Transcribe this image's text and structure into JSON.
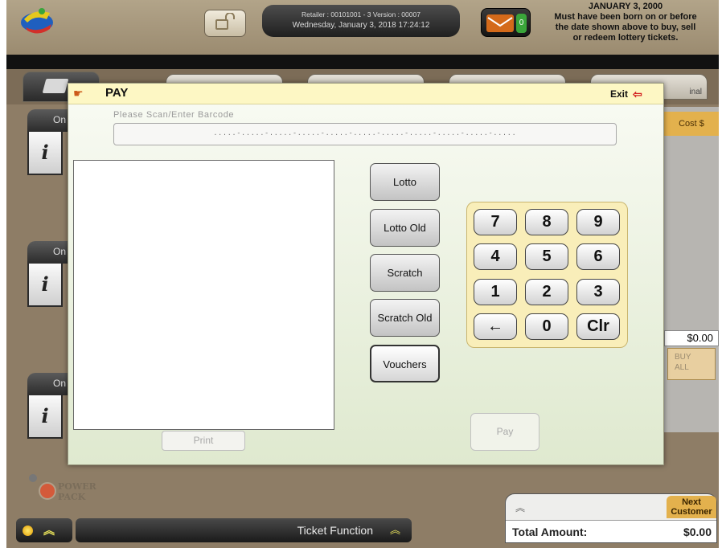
{
  "header": {
    "retailer_line": "Retailer : 00101001 - 3     Version : 00007",
    "datetime_line": "Wednesday, January 3, 2018 17:24:12",
    "mail_count": "0",
    "age_notice_date": "JANUARY 3, 2000",
    "age_notice_lines": [
      "Must have been born on or before",
      "the date shown above to buy, sell",
      "or redeem lottery tickets."
    ]
  },
  "side_panels": [
    {
      "header": "On",
      "info": "i"
    },
    {
      "header": "On",
      "info": "i"
    },
    {
      "header": "On",
      "info": "i"
    }
  ],
  "tabs": {
    "partial_label": "inal"
  },
  "right_panel": {
    "cost_header": "Cost $",
    "cost_amount": "$0.00",
    "buy_all": [
      "BUY",
      "ALL"
    ]
  },
  "dialog": {
    "title": "PAY",
    "exit_label": "Exit",
    "scan_label": "Please Scan/Enter Barcode",
    "scan_mask": ".....-.....-.....-.....-.....-.....-.....-.....-.....-.....-.....",
    "type_buttons": [
      "Lotto",
      "Lotto Old",
      "Scratch",
      "Scratch Old",
      "Vouchers"
    ],
    "keypad": [
      "7",
      "8",
      "9",
      "4",
      "5",
      "6",
      "1",
      "2",
      "3",
      "←",
      "0",
      "Clr"
    ],
    "print_label": "Print",
    "pay_label": "Pay"
  },
  "bottom": {
    "power_pack": [
      "POWER",
      "PACK"
    ],
    "ticket_function": "Ticket Function",
    "next_customer": [
      "Next",
      "Customer"
    ],
    "total_label": "Total Amount:",
    "total_value": "$0.00"
  },
  "colors": {
    "accent_orange": "#e3b14d",
    "dialog_title_bg": "#fdf7c4",
    "keypad_bg": "#f9eeb9"
  }
}
